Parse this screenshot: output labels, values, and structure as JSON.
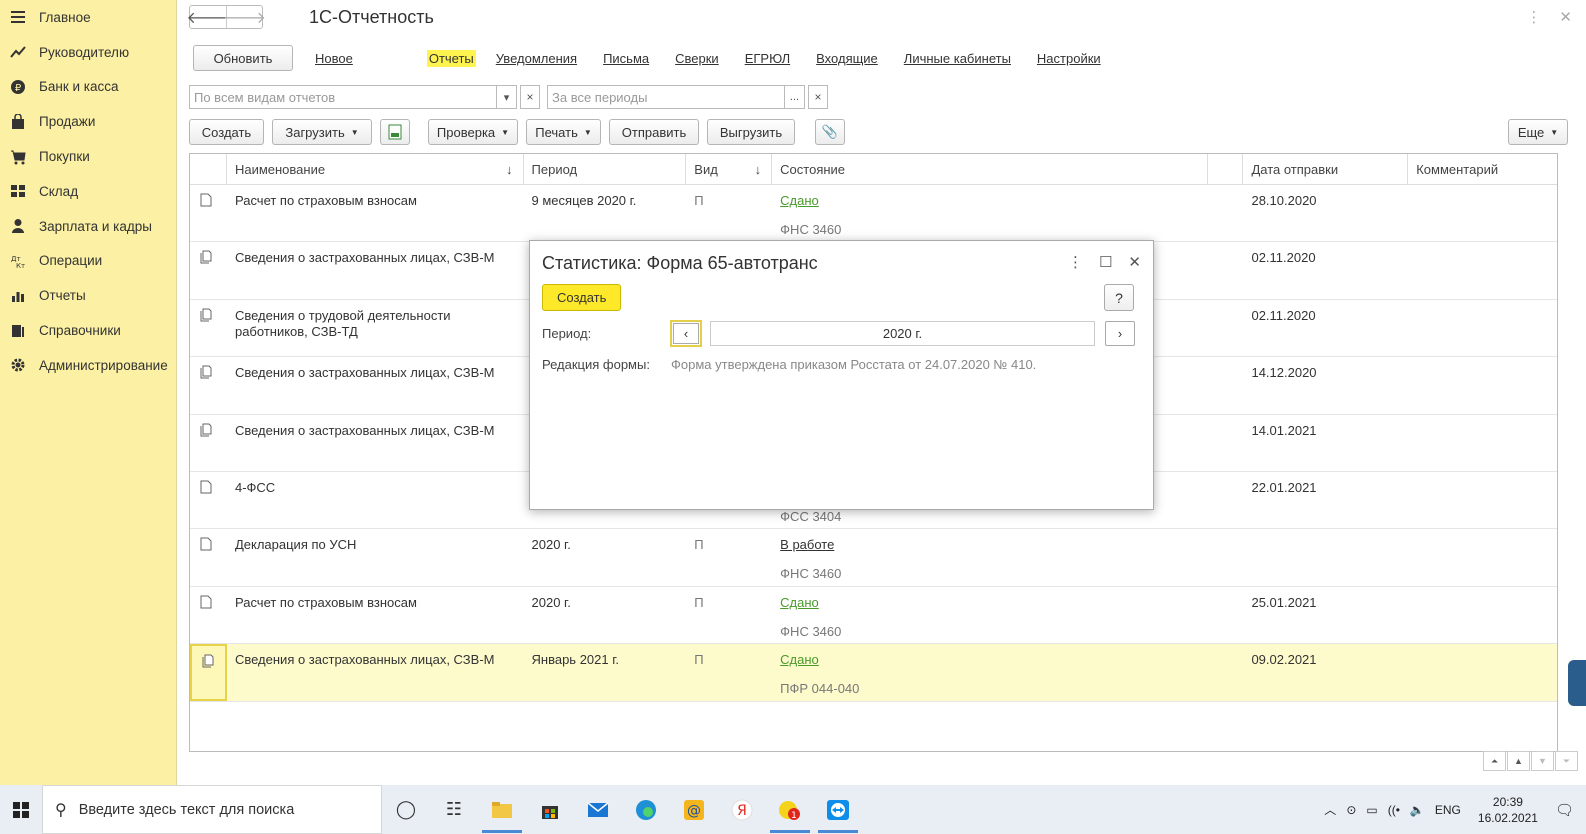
{
  "sidebar": {
    "items": [
      {
        "label": "Главное",
        "icon": "menu-icon"
      },
      {
        "label": "Руководителю",
        "icon": "trend-icon"
      },
      {
        "label": "Банк и касса",
        "icon": "ruble-icon"
      },
      {
        "label": "Продажи",
        "icon": "bag-icon"
      },
      {
        "label": "Покупки",
        "icon": "cart-icon"
      },
      {
        "label": "Склад",
        "icon": "grid-icon"
      },
      {
        "label": "Зарплата и кадры",
        "icon": "person-icon"
      },
      {
        "label": "Операции",
        "icon": "dt-kt-icon"
      },
      {
        "label": "Отчеты",
        "icon": "bar-chart-icon"
      },
      {
        "label": "Справочники",
        "icon": "books-icon"
      },
      {
        "label": "Администрирование",
        "icon": "gear-icon"
      }
    ]
  },
  "header": {
    "title": "1С-Отчетность"
  },
  "tabs": {
    "refresh": "Обновить",
    "items": [
      "Новое",
      "Отчеты",
      "Уведомления",
      "Письма",
      "Сверки",
      "ЕГРЮЛ",
      "Входящие",
      "Личные кабинеты",
      "Настройки"
    ]
  },
  "filters": {
    "report_type_placeholder": "По всем видам отчетов",
    "period_placeholder": "За все периоды",
    "clear": "×",
    "ellipsis": "..."
  },
  "toolbar": {
    "create": "Создать",
    "load": "Загрузить",
    "check": "Проверка",
    "print": "Печать",
    "send": "Отправить",
    "export": "Выгрузить",
    "more": "Еще"
  },
  "table": {
    "headers": {
      "name": "Наименование",
      "period": "Период",
      "type": "Вид",
      "status": "Состояние",
      "sent_date": "Дата отправки",
      "comment": "Комментарий"
    },
    "rows": [
      {
        "name": "Расчет по страховым взносам",
        "period": "9 месяцев 2020 г.",
        "type": "П",
        "status": "Сдано",
        "org": "ФНС 3460",
        "date": "28.10.2020"
      },
      {
        "name": "Сведения о застрахованных лицах, СЗВ-М",
        "period": "",
        "type": "",
        "status": "",
        "org": "",
        "date": "02.11.2020"
      },
      {
        "name": "Сведения о трудовой деятельности работников, СЗВ-ТД",
        "period": "",
        "type": "",
        "status": "",
        "org": "",
        "date": "02.11.2020"
      },
      {
        "name": "Сведения о застрахованных лицах, СЗВ-М",
        "period": "",
        "type": "",
        "status": "",
        "org": "",
        "date": "14.12.2020"
      },
      {
        "name": "Сведения о застрахованных лицах, СЗВ-М",
        "period": "",
        "type": "",
        "status": "",
        "org": "",
        "date": "14.01.2021"
      },
      {
        "name": "4-ФСС",
        "period": "",
        "type": "",
        "status": "",
        "org": "ФСС 3404",
        "date": "22.01.2021"
      },
      {
        "name": "Декларация по УСН",
        "period": "2020 г.",
        "type": "П",
        "status": "В работе",
        "org": "ФНС 3460",
        "date": ""
      },
      {
        "name": "Расчет по страховым взносам",
        "period": "2020 г.",
        "type": "П",
        "status": "Сдано",
        "org": "ФНС 3460",
        "date": "25.01.2021"
      },
      {
        "name": "Сведения о застрахованных лицах, СЗВ-М",
        "period": "Январь 2021 г.",
        "type": "П",
        "status": "Сдано",
        "org": "ПФР 044-040",
        "date": "09.02.2021"
      }
    ]
  },
  "modal": {
    "title": "Статистика: Форма 65-автотранс",
    "create": "Создать",
    "help": "?",
    "period_label": "Период:",
    "period_value": "2020 г.",
    "edition_label": "Редакция формы:",
    "edition_value": "Форма утверждена приказом Росстата от 24.07.2020 № 410."
  },
  "taskbar": {
    "search_placeholder": "Введите здесь текст для поиска",
    "lang": "ENG",
    "time": "20:39",
    "date": "16.02.2021"
  },
  "colors": {
    "sidebar_bg": "#fbf0a3",
    "accent_yellow": "#fde92a",
    "status_green": "#4a9a2a"
  }
}
